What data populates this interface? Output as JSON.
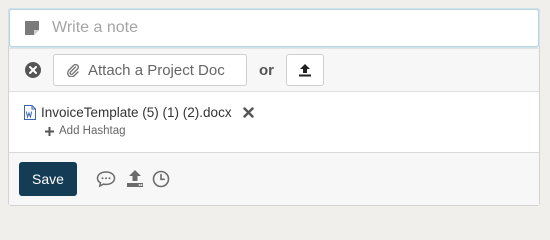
{
  "note": {
    "placeholder": "Write a note"
  },
  "attach": {
    "button_label": "Attach a Project Doc",
    "or_label": "or"
  },
  "files": [
    {
      "name": "InvoiceTemplate (5) (1) (2).docx"
    }
  ],
  "hashtag": {
    "label": "Add Hashtag"
  },
  "toolbar": {
    "save_label": "Save"
  },
  "colors": {
    "save_bg": "#153c55",
    "icon_gray": "#6b6b6b",
    "doc_icon": "#3b66b0",
    "focus_border": "#b9d3e0"
  }
}
